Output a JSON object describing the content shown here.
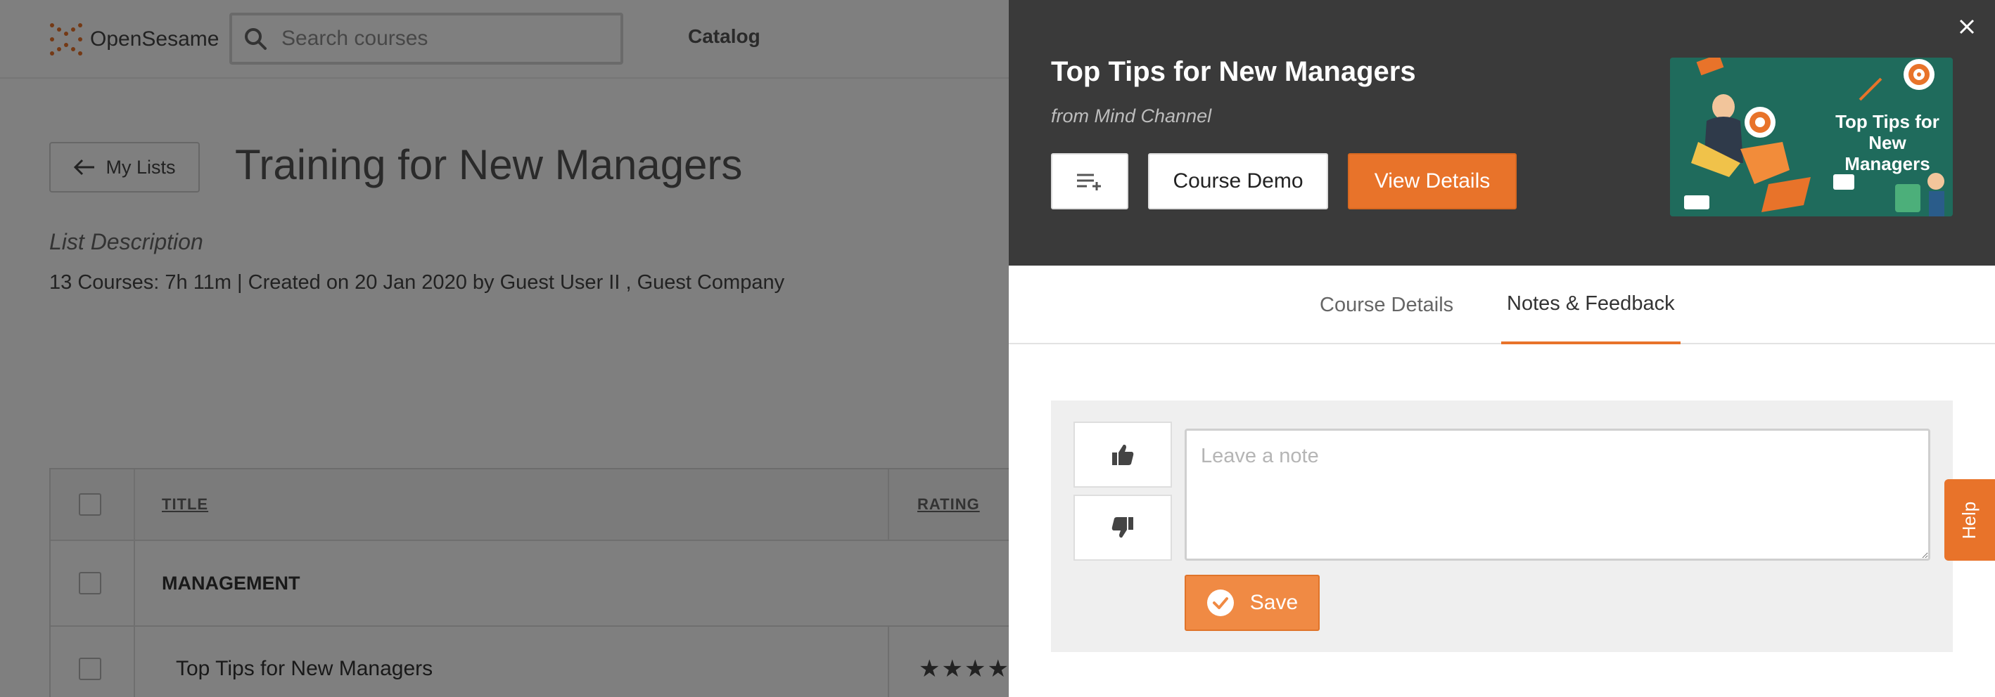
{
  "header": {
    "logo_text": "OpenSesame",
    "search_placeholder": "Search courses",
    "catalog_label": "Catalog"
  },
  "page": {
    "back_label": "My Lists",
    "title": "Training for New Managers",
    "description_label": "List Description",
    "meta": "13 Courses: 7h 11m | Created on 20 Jan 2020 by Guest User II , Guest Company"
  },
  "table": {
    "columns": [
      "TITLE",
      "RATING"
    ],
    "group_label": "MANAGEMENT",
    "rows": [
      {
        "title": "Top Tips for New Managers",
        "rating": "★★★★"
      }
    ]
  },
  "modal": {
    "course_title": "Top Tips for New Managers",
    "source": "from Mind Channel",
    "buttons": {
      "demo": "Course Demo",
      "details": "View Details"
    },
    "thumbnail_text": "Top Tips for New Managers",
    "tabs": [
      {
        "label": "Course Details",
        "active": false
      },
      {
        "label": "Notes & Feedback",
        "active": true
      }
    ],
    "notes": {
      "placeholder": "Leave a note",
      "save_label": "Save"
    }
  },
  "help_label": "Help",
  "colors": {
    "accent": "#e8732a",
    "header_bg": "#3a3a3a",
    "overlay": "rgba(0,0,0,0.5)"
  },
  "icons": [
    "search-icon",
    "arrow-left-icon",
    "add-to-list-icon",
    "close-icon",
    "thumbs-up-icon",
    "thumbs-down-icon",
    "check-circle-icon",
    "logo-icon"
  ]
}
